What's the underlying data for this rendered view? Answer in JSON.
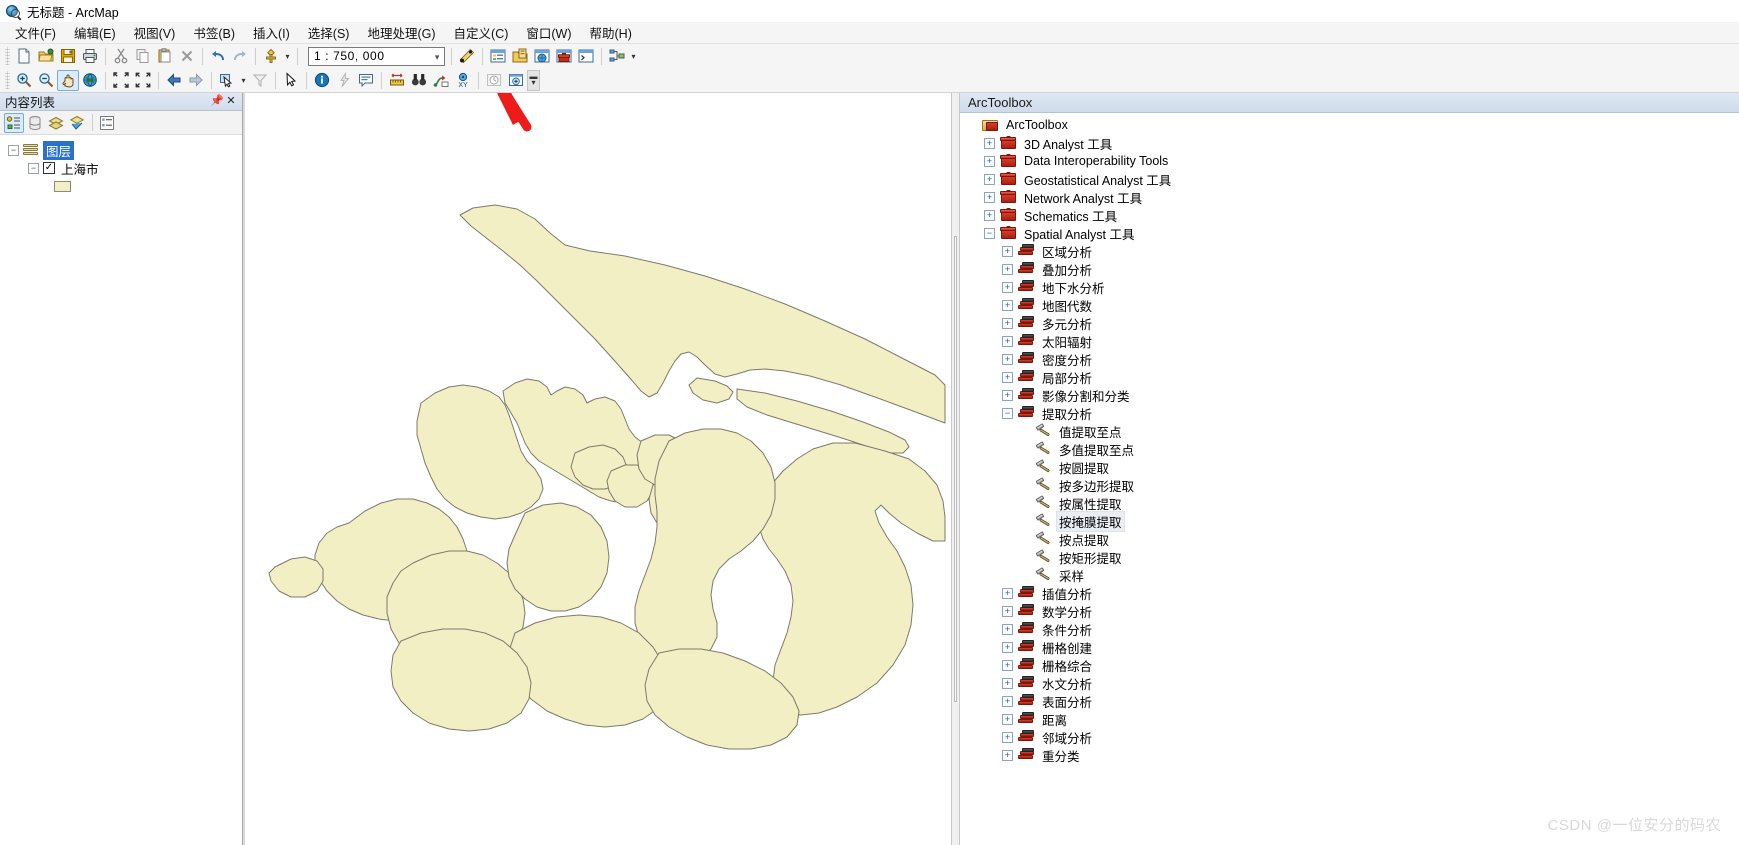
{
  "window": {
    "title": "无标题 - ArcMap",
    "app_icon": "arcmap-globe-icon"
  },
  "menubar": {
    "items": [
      {
        "label": "文件(F)",
        "name": "menu-file"
      },
      {
        "label": "编辑(E)",
        "name": "menu-edit"
      },
      {
        "label": "视图(V)",
        "name": "menu-view"
      },
      {
        "label": "书签(B)",
        "name": "menu-bookmarks"
      },
      {
        "label": "插入(I)",
        "name": "menu-insert"
      },
      {
        "label": "选择(S)",
        "name": "menu-selection"
      },
      {
        "label": "地理处理(G)",
        "name": "menu-geoprocessing"
      },
      {
        "label": "自定义(C)",
        "name": "menu-customize"
      },
      {
        "label": "窗口(W)",
        "name": "menu-window"
      },
      {
        "label": "帮助(H)",
        "name": "menu-help"
      }
    ]
  },
  "toolbar_standard": {
    "scale": {
      "value": "1 : 750, 000",
      "placeholder": "1 : 750, 000"
    },
    "buttons": [
      {
        "name": "new-map-button",
        "icon": "new-document-icon",
        "tooltip": "新建地图文档"
      },
      {
        "name": "open-button",
        "icon": "open-folder-icon",
        "tooltip": "打开"
      },
      {
        "name": "save-button",
        "icon": "floppy-disk-icon",
        "tooltip": "保存"
      },
      {
        "name": "print-button",
        "icon": "printer-icon",
        "tooltip": "打印"
      },
      {
        "name": "cut-button",
        "icon": "scissors-icon",
        "tooltip": "剪切"
      },
      {
        "name": "copy-button",
        "icon": "copy-icon",
        "tooltip": "复制"
      },
      {
        "name": "paste-button",
        "icon": "clipboard-paste-icon",
        "tooltip": "粘贴"
      },
      {
        "name": "delete-button",
        "icon": "delete-x-icon",
        "tooltip": "删除"
      },
      {
        "name": "undo-button",
        "icon": "undo-arrow-icon",
        "tooltip": "撤销"
      },
      {
        "name": "redo-button",
        "icon": "redo-arrow-icon",
        "tooltip": "重做"
      },
      {
        "name": "add-data-button",
        "icon": "add-data-diamond-icon",
        "tooltip": "添加数据"
      },
      {
        "name": "editor-toolbar-button",
        "icon": "editor-pencil-icon",
        "tooltip": "编辑器工具条"
      },
      {
        "name": "toc-window-button",
        "icon": "table-of-contents-icon",
        "tooltip": "内容列表"
      },
      {
        "name": "catalog-window-button",
        "icon": "catalog-icon",
        "tooltip": "目录"
      },
      {
        "name": "search-window-button",
        "icon": "search-globe-icon",
        "tooltip": "搜索"
      },
      {
        "name": "arctoolbox-button",
        "icon": "arctoolbox-red-case-icon",
        "tooltip": "ArcToolbox"
      },
      {
        "name": "python-window-button",
        "icon": "python-prompt-icon",
        "tooltip": "Python 窗口"
      },
      {
        "name": "model-builder-button",
        "icon": "model-builder-icon",
        "tooltip": "ModelBuilder"
      }
    ]
  },
  "toolbar_tools": {
    "buttons": [
      {
        "name": "zoom-in-button",
        "icon": "magnifier-plus-icon",
        "tooltip": "放大"
      },
      {
        "name": "zoom-out-button",
        "icon": "magnifier-minus-icon",
        "tooltip": "缩小"
      },
      {
        "name": "pan-button",
        "icon": "hand-pan-icon",
        "tooltip": "平移",
        "active": true
      },
      {
        "name": "full-extent-button",
        "icon": "globe-full-extent-icon",
        "tooltip": "全图"
      },
      {
        "name": "fixed-zoom-in-button",
        "icon": "fixed-zoom-in-icon",
        "tooltip": "固定比例放大"
      },
      {
        "name": "fixed-zoom-out-button",
        "icon": "fixed-zoom-out-icon",
        "tooltip": "固定比例缩小"
      },
      {
        "name": "go-back-extent-button",
        "icon": "arrow-left-icon",
        "tooltip": "返回上一视图"
      },
      {
        "name": "go-forward-extent-button",
        "icon": "arrow-right-icon",
        "tooltip": "转到下一视图"
      },
      {
        "name": "select-features-button",
        "icon": "select-features-icon",
        "tooltip": "选择要素"
      },
      {
        "name": "clear-selection-button",
        "icon": "clear-selection-icon",
        "tooltip": "清除所选要素"
      },
      {
        "name": "select-elements-button",
        "icon": "arrow-pointer-icon",
        "tooltip": "选择元素"
      },
      {
        "name": "identify-button",
        "icon": "identify-info-icon",
        "tooltip": "识别"
      },
      {
        "name": "hyperlink-button",
        "icon": "hyperlink-lightning-icon",
        "tooltip": "超链接"
      },
      {
        "name": "html-popup-button",
        "icon": "html-popup-icon",
        "tooltip": "HTML 弹出窗口"
      },
      {
        "name": "measure-button",
        "icon": "measure-ruler-icon",
        "tooltip": "测量"
      },
      {
        "name": "find-button",
        "icon": "binoculars-icon",
        "tooltip": "查找"
      },
      {
        "name": "find-route-button",
        "icon": "find-route-icon",
        "tooltip": "查找路径"
      },
      {
        "name": "go-to-xy-button",
        "icon": "go-to-xy-icon",
        "tooltip": "转到 XY"
      },
      {
        "name": "time-slider-button",
        "icon": "clock-time-slider-icon",
        "tooltip": "时间滑块"
      },
      {
        "name": "create-viewer-button",
        "icon": "create-viewer-window-icon",
        "tooltip": "创建视图窗口"
      }
    ],
    "overflow": "toolbar-overflow-button"
  },
  "toc": {
    "title": "内容列表",
    "pin_icon": "pin-icon",
    "close_icon": "close-icon",
    "toolbar": [
      {
        "name": "list-by-drawing-order-button",
        "icon": "list-by-drawing-order-icon",
        "active": true
      },
      {
        "name": "list-by-source-button",
        "icon": "list-by-source-icon",
        "active": false
      },
      {
        "name": "list-by-visibility-button",
        "icon": "list-by-visibility-icon",
        "active": false
      },
      {
        "name": "list-by-selection-button",
        "icon": "list-by-selection-icon",
        "active": false
      },
      {
        "name": "toc-options-button",
        "icon": "toc-options-icon",
        "active": false
      }
    ],
    "tree": {
      "root_label": "图层",
      "layer_label": "上海市",
      "layer_checked": true,
      "swatch_color": "#f2efc4",
      "swatch_outline": "#8d8d77"
    }
  },
  "map": {
    "fill_color": "#f2efc4",
    "stroke_color": "#7d7a6b",
    "background": "#ffffff",
    "annotation": {
      "name": "red-arrow-annotation",
      "color": "#ee1b1b",
      "points_to": "arctoolbox-button"
    }
  },
  "arctoolbox": {
    "title": "ArcToolbox",
    "tree": [
      {
        "label": "ArcToolbox",
        "depth": 0,
        "icon": "arctoolbox-root-icon",
        "state": "none"
      },
      {
        "label": "3D Analyst 工具",
        "depth": 1,
        "icon": "toolbox-icon",
        "state": "collapsed"
      },
      {
        "label": "Data Interoperability Tools",
        "depth": 1,
        "icon": "toolbox-icon",
        "state": "collapsed"
      },
      {
        "label": "Geostatistical Analyst 工具",
        "depth": 1,
        "icon": "toolbox-icon",
        "state": "collapsed"
      },
      {
        "label": "Network Analyst 工具",
        "depth": 1,
        "icon": "toolbox-icon",
        "state": "collapsed"
      },
      {
        "label": "Schematics 工具",
        "depth": 1,
        "icon": "toolbox-icon",
        "state": "collapsed"
      },
      {
        "label": "Spatial Analyst 工具",
        "depth": 1,
        "icon": "toolbox-icon",
        "state": "expanded"
      },
      {
        "label": "区域分析",
        "depth": 2,
        "icon": "toolset-icon",
        "state": "collapsed"
      },
      {
        "label": "叠加分析",
        "depth": 2,
        "icon": "toolset-icon",
        "state": "collapsed"
      },
      {
        "label": "地下水分析",
        "depth": 2,
        "icon": "toolset-icon",
        "state": "collapsed"
      },
      {
        "label": "地图代数",
        "depth": 2,
        "icon": "toolset-icon",
        "state": "collapsed"
      },
      {
        "label": "多元分析",
        "depth": 2,
        "icon": "toolset-icon",
        "state": "collapsed"
      },
      {
        "label": "太阳辐射",
        "depth": 2,
        "icon": "toolset-icon",
        "state": "collapsed"
      },
      {
        "label": "密度分析",
        "depth": 2,
        "icon": "toolset-icon",
        "state": "collapsed"
      },
      {
        "label": "局部分析",
        "depth": 2,
        "icon": "toolset-icon",
        "state": "collapsed"
      },
      {
        "label": "影像分割和分类",
        "depth": 2,
        "icon": "toolset-icon",
        "state": "collapsed"
      },
      {
        "label": "提取分析",
        "depth": 2,
        "icon": "toolset-icon",
        "state": "expanded"
      },
      {
        "label": "值提取至点",
        "depth": 3,
        "icon": "tool-hammer-icon",
        "state": "none"
      },
      {
        "label": "多值提取至点",
        "depth": 3,
        "icon": "tool-hammer-icon",
        "state": "none"
      },
      {
        "label": "按圆提取",
        "depth": 3,
        "icon": "tool-hammer-icon",
        "state": "none"
      },
      {
        "label": "按多边形提取",
        "depth": 3,
        "icon": "tool-hammer-icon",
        "state": "none"
      },
      {
        "label": "按属性提取",
        "depth": 3,
        "icon": "tool-hammer-icon",
        "state": "none"
      },
      {
        "label": "按掩膜提取",
        "depth": 3,
        "icon": "tool-hammer-icon",
        "state": "none",
        "hover": true
      },
      {
        "label": "按点提取",
        "depth": 3,
        "icon": "tool-hammer-icon",
        "state": "none"
      },
      {
        "label": "按矩形提取",
        "depth": 3,
        "icon": "tool-hammer-icon",
        "state": "none"
      },
      {
        "label": "采样",
        "depth": 3,
        "icon": "tool-hammer-icon",
        "state": "none"
      },
      {
        "label": "插值分析",
        "depth": 2,
        "icon": "toolset-icon",
        "state": "collapsed"
      },
      {
        "label": "数学分析",
        "depth": 2,
        "icon": "toolset-icon",
        "state": "collapsed"
      },
      {
        "label": "条件分析",
        "depth": 2,
        "icon": "toolset-icon",
        "state": "collapsed"
      },
      {
        "label": "栅格创建",
        "depth": 2,
        "icon": "toolset-icon",
        "state": "collapsed"
      },
      {
        "label": "栅格综合",
        "depth": 2,
        "icon": "toolset-icon",
        "state": "collapsed"
      },
      {
        "label": "水文分析",
        "depth": 2,
        "icon": "toolset-icon",
        "state": "collapsed"
      },
      {
        "label": "表面分析",
        "depth": 2,
        "icon": "toolset-icon",
        "state": "collapsed"
      },
      {
        "label": "距离",
        "depth": 2,
        "icon": "toolset-icon",
        "state": "collapsed"
      },
      {
        "label": "邻域分析",
        "depth": 2,
        "icon": "toolset-icon",
        "state": "collapsed"
      },
      {
        "label": "重分类",
        "depth": 2,
        "icon": "toolset-icon",
        "state": "collapsed"
      }
    ]
  },
  "watermark": {
    "text": "CSDN @一位安分的码农"
  }
}
